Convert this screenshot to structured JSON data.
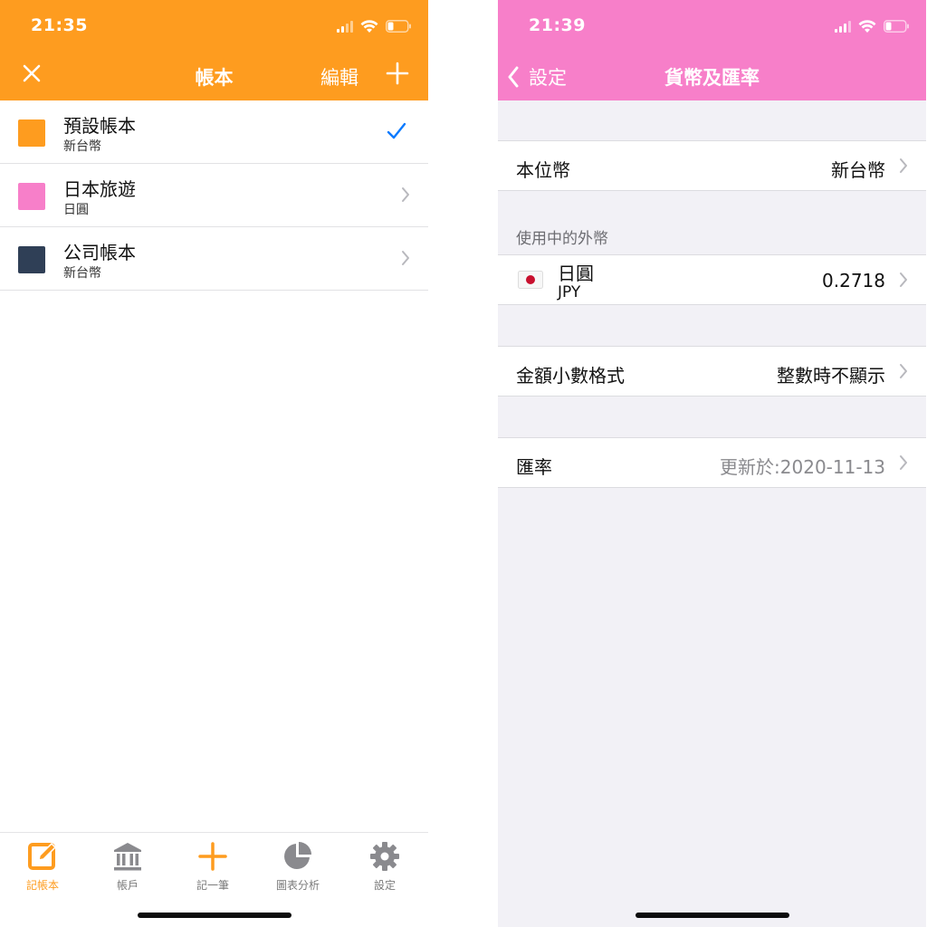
{
  "left": {
    "status_time": "21:35",
    "nav": {
      "title": "帳本",
      "edit_label": "編輯",
      "close_icon": "close-icon",
      "add_icon": "plus-icon"
    },
    "colors": {
      "accent": "#fe9c1f"
    },
    "ledgers": [
      {
        "name": "預設帳本",
        "currency": "新台幣",
        "color": "#fe9c1f",
        "selected": true
      },
      {
        "name": "日本旅遊",
        "currency": "日圓",
        "color": "#f77fc9",
        "selected": false
      },
      {
        "name": "公司帳本",
        "currency": "新台幣",
        "color": "#2f3f56",
        "selected": false
      }
    ],
    "tabs": [
      {
        "label": "記帳本",
        "icon": "edit-icon",
        "active": true
      },
      {
        "label": "帳戶",
        "icon": "bank-icon",
        "active": false
      },
      {
        "label": "記一筆",
        "icon": "plus-icon",
        "active": false
      },
      {
        "label": "圖表分析",
        "icon": "pie-chart-icon",
        "active": false
      },
      {
        "label": "設定",
        "icon": "gear-icon",
        "active": false
      }
    ]
  },
  "right": {
    "status_time": "21:39",
    "nav": {
      "back_label": "設定",
      "title": "貨幣及匯率"
    },
    "colors": {
      "accent": "#f77fc9"
    },
    "base_currency": {
      "label": "本位幣",
      "value": "新台幣"
    },
    "foreign_section_header": "使用中的外幣",
    "foreign_currency": {
      "name": "日圓",
      "code": "JPY",
      "rate": "0.2718",
      "flag_icon": "japan-flag-icon"
    },
    "decimal_format": {
      "label": "金額小數格式",
      "value": "整數時不顯示"
    },
    "exchange_rate": {
      "label": "匯率",
      "value": "更新於:2020-11-13"
    }
  }
}
